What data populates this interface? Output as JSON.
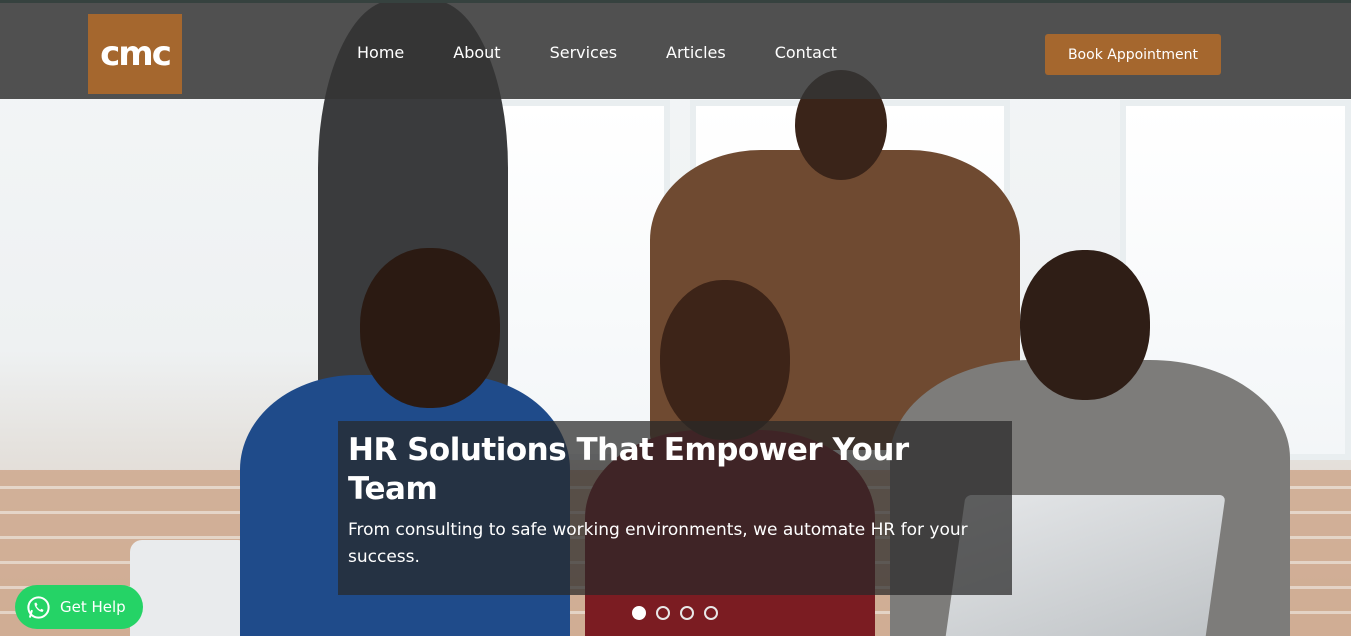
{
  "brand": {
    "logo_text": "cmc",
    "accent_color": "#a5672e",
    "navbar_bg": "#343434"
  },
  "nav": {
    "items": [
      {
        "label": "Home"
      },
      {
        "label": "About"
      },
      {
        "label": "Services"
      },
      {
        "label": "Articles"
      },
      {
        "label": "Contact"
      }
    ],
    "cta_label": "Book Appointment"
  },
  "hero": {
    "title": "HR Solutions That Empower Your Team",
    "subtitle": "From consulting to safe working environments, we automate HR for your success.",
    "image_description": "Office meeting with professionals shaking hands",
    "slides_total": 4,
    "active_slide": 1
  },
  "help": {
    "label": "Get Help",
    "icon": "whatsapp-icon",
    "color": "#25d366"
  }
}
